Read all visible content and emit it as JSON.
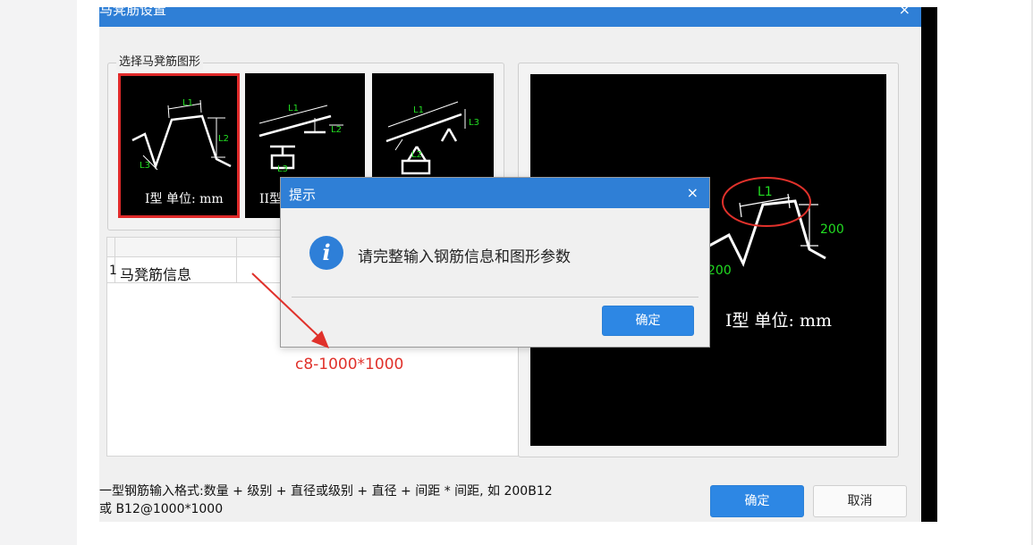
{
  "dialog": {
    "title": "马凳筋设置",
    "close_glyph": "×",
    "group_title": "选择马凳筋图形",
    "shapes": [
      {
        "label": "I型 单位: mm",
        "selected": true
      },
      {
        "label": "II型",
        "selected": false
      },
      {
        "label": "",
        "selected": false
      }
    ],
    "tile_labels": {
      "l1": "L1",
      "l2": "L2",
      "l3": "L3"
    },
    "table": {
      "row_number": "1",
      "row_label": "马凳筋信息"
    },
    "preview": {
      "l1": "L1",
      "dim_right": "200",
      "dim_left": "200",
      "label": "I型 单位: mm"
    },
    "hint_line1": "一型钢筋输入格式:数量 + 级别 + 直径或级别 + 直径 + 间距 * 间距, 如 200B12",
    "hint_line2": "或 B12@1000*1000",
    "ok_label": "确定",
    "cancel_label": "取消"
  },
  "message_box": {
    "title": "提示",
    "close_glyph": "×",
    "icon": "info-icon",
    "message": "请完整输入钢筋信息和图形参数",
    "ok_label": "确定"
  },
  "annotation": {
    "text": "c8-1000*1000",
    "color": "#e0312b"
  },
  "colors": {
    "title_bar": "#2f7fd6",
    "primary_button": "#2d87e4",
    "selection": "#e02a2a",
    "dimension_text": "#22dd22"
  }
}
